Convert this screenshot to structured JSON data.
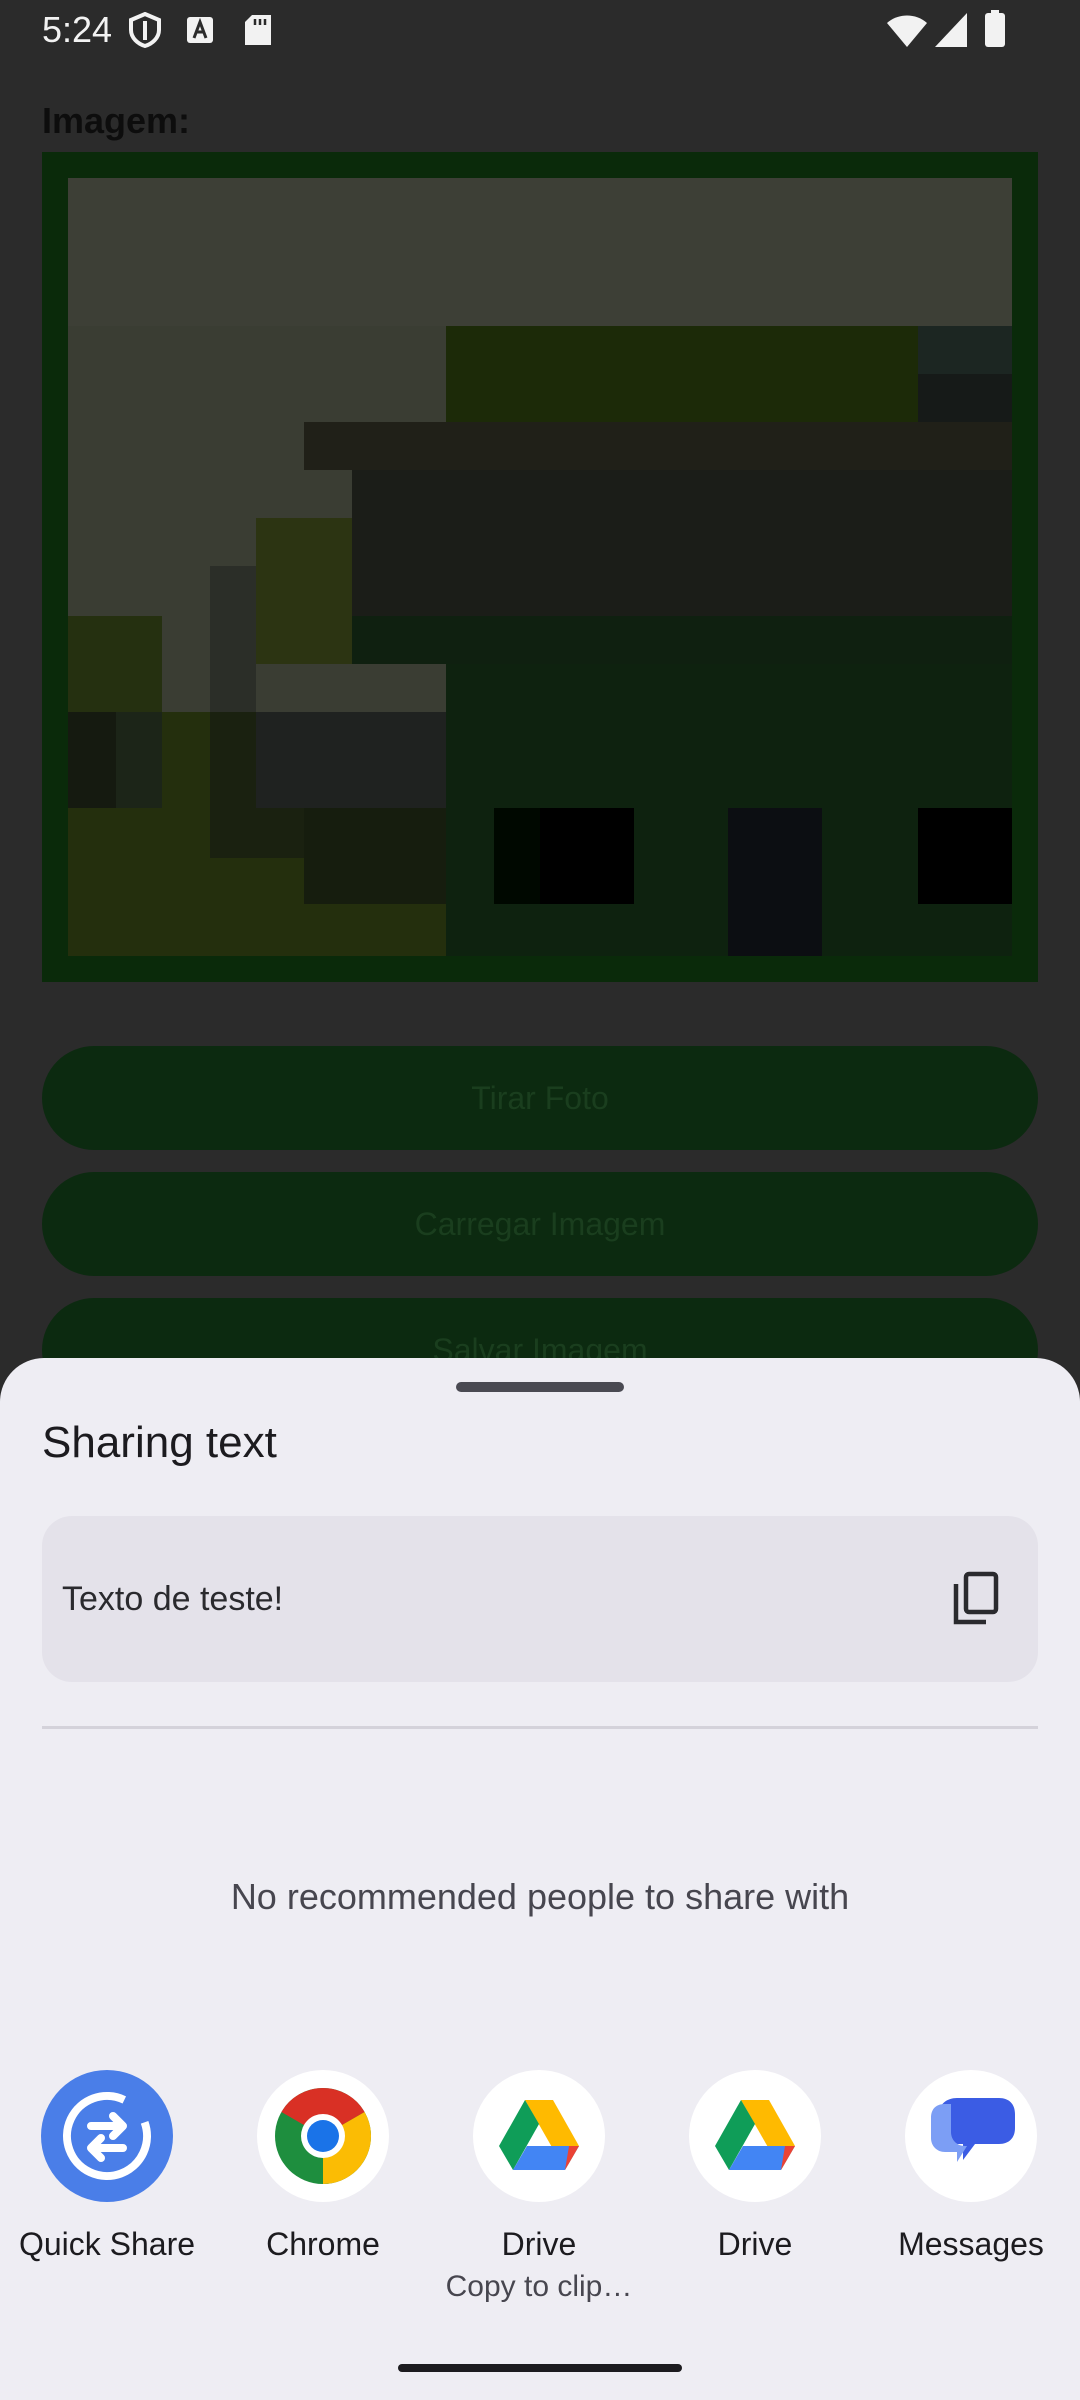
{
  "status_bar": {
    "time": "5:24",
    "left_icons": [
      "shield-icon",
      "autofill-icon",
      "sd-card-icon"
    ],
    "right_icons": [
      "wifi-icon",
      "cell-signal-icon",
      "battery-icon"
    ]
  },
  "app": {
    "image_label": "Imagem:",
    "buttons": {
      "take_photo": "Tirar Foto",
      "load_image": "Carregar Imagem",
      "save_image": "Salvar Imagem"
    }
  },
  "share_sheet": {
    "title": "Sharing text",
    "shared_text": "Texto de teste!",
    "copy_icon": "copy-icon",
    "no_recommendations": "No recommended people to share with",
    "apps": [
      {
        "label": "Quick Share",
        "icon": "quick-share-icon"
      },
      {
        "label": "Chrome",
        "icon": "chrome-icon"
      },
      {
        "label": "Drive",
        "sublabel": "Copy to clip…",
        "icon": "drive-icon"
      },
      {
        "label": "Drive",
        "icon": "drive-icon"
      },
      {
        "label": "Messages",
        "icon": "messages-icon"
      }
    ]
  },
  "colors": {
    "sheet_background": "#eeedf3",
    "quick_share_blue": "#4a7ee8",
    "scrim": "#2b2b2b"
  }
}
